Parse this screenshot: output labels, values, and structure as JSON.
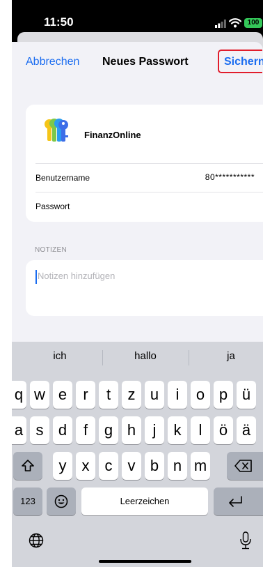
{
  "status_bar": {
    "time": "11:50",
    "battery": "100"
  },
  "nav": {
    "cancel": "Abbrechen",
    "title": "Neues Passwort",
    "save": "Sichern"
  },
  "account": {
    "app_name": "FinanzOnline",
    "username_label": "Benutzername",
    "username_value": "80***********",
    "password_label": "Passwort"
  },
  "notes": {
    "header": "NOTIZEN",
    "placeholder": "Notizen hinzufügen"
  },
  "keyboard": {
    "suggestions": [
      "ich",
      "hallo",
      "ja"
    ],
    "row1": [
      "q",
      "w",
      "e",
      "r",
      "t",
      "z",
      "u",
      "i",
      "o",
      "p",
      "ü"
    ],
    "row2": [
      "a",
      "s",
      "d",
      "f",
      "g",
      "h",
      "j",
      "k",
      "l",
      "ö",
      "ä"
    ],
    "row3": [
      "y",
      "x",
      "c",
      "v",
      "b",
      "n",
      "m"
    ],
    "numbers_key": "123",
    "space": "Leerzeichen",
    "icons": {
      "shift": "shift-icon",
      "delete": "delete-icon",
      "emoji": "emoji-icon",
      "return": "return-icon",
      "globe": "globe-icon",
      "dictation": "microphone-icon"
    }
  },
  "colors": {
    "accent": "#1a6cf0",
    "highlight_border": "#e11d2c",
    "battery": "#34c759"
  }
}
